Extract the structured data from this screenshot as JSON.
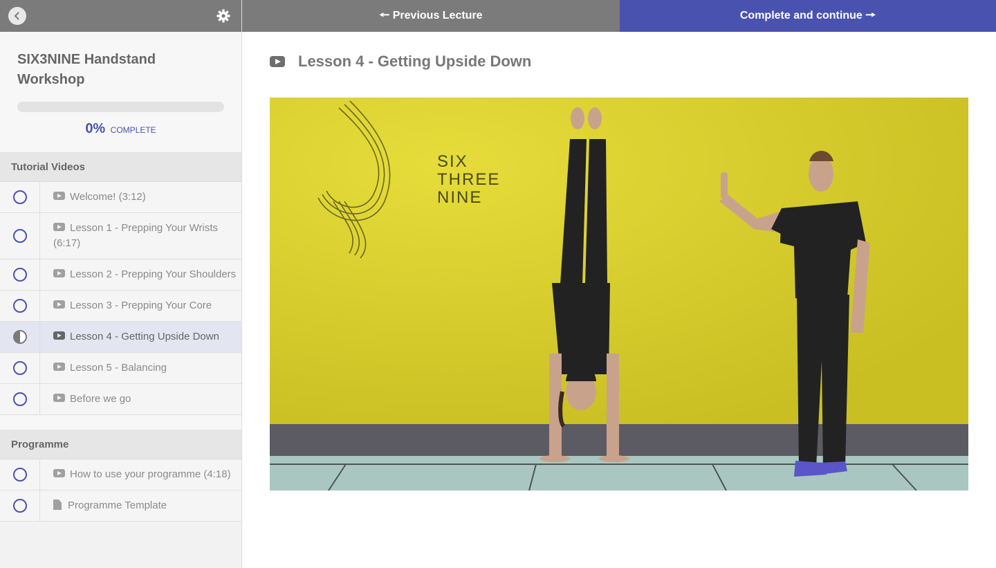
{
  "sidebar": {
    "course_title": "SIX3NINE Handstand Workshop",
    "progress": {
      "percent_label": "0%",
      "label": "COMPLETE",
      "value": 0
    },
    "sections": [
      {
        "title": "Tutorial Videos",
        "items": [
          {
            "label": "Welcome! (3:12)",
            "icon": "play-icon",
            "status": "not-started"
          },
          {
            "label": "Lesson 1 - Prepping Your Wrists (6:17)",
            "icon": "play-icon",
            "status": "not-started"
          },
          {
            "label": "Lesson 2 - Prepping Your Shoulders",
            "icon": "play-icon",
            "status": "not-started"
          },
          {
            "label": "Lesson 3 - Prepping Your Core",
            "icon": "play-icon",
            "status": "not-started"
          },
          {
            "label": "Lesson 4 - Getting Upside Down",
            "icon": "play-icon",
            "status": "in-progress"
          },
          {
            "label": "Lesson 5 - Balancing",
            "icon": "play-icon",
            "status": "not-started"
          },
          {
            "label": "Before we go",
            "icon": "play-icon",
            "status": "not-started"
          }
        ]
      },
      {
        "title": "Programme",
        "items": [
          {
            "label": "How to use your programme (4:18)",
            "icon": "play-icon",
            "status": "not-started"
          },
          {
            "label": "Programme Template",
            "icon": "document-icon",
            "status": "not-started"
          }
        ]
      }
    ]
  },
  "nav": {
    "prev_label": "Previous Lecture",
    "next_label": "Complete and continue"
  },
  "lecture": {
    "title": "Lesson 4 - Getting Upside Down"
  },
  "video": {
    "wall_text": [
      "SIX",
      "THREE",
      "NINE"
    ]
  },
  "colors": {
    "accent": "#4a52b0",
    "nav_gray": "#7b7b7b",
    "wall_yellow": "#cfc42a"
  }
}
